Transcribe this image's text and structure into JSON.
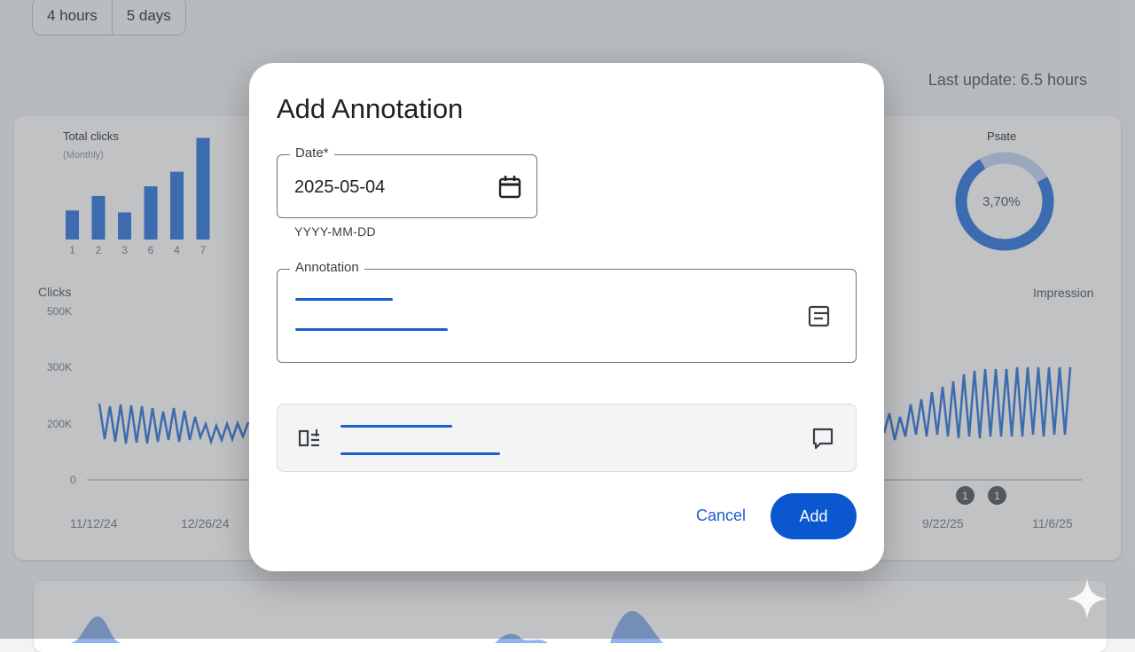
{
  "time_range": {
    "options": [
      "4 hours",
      "5 days"
    ]
  },
  "last_update": "Last update: 6.5 hours",
  "summary": {
    "total_clicks": {
      "title": "Total clicks",
      "subtitle": "(Monthly)",
      "chart_data": {
        "type": "bar",
        "categories": [
          "1",
          "2",
          "3",
          "6",
          "4",
          "7"
        ],
        "values": [
          3,
          4.5,
          2.8,
          5.5,
          7,
          10.5
        ]
      }
    },
    "position": {
      "title": "Psate",
      "chart_data": {
        "type": "pie",
        "values": [
          3.7
        ],
        "display": "3,70%"
      }
    }
  },
  "performance_chart": {
    "y_label": "Clicks",
    "y2_label": "Impression",
    "y_ticks": [
      "500K",
      "300K",
      "200K",
      "0"
    ],
    "x_ticks": [
      "11/12/24",
      "12/26/24",
      "9/22/25",
      "11/6/25"
    ],
    "annotation_markers": [
      "1",
      "1"
    ]
  },
  "dialog": {
    "title": "Add Annotation",
    "date_label": "Date*",
    "date_value": "2025-05-04",
    "date_helper": "YYYY-MM-DD",
    "annotation_label": "Annotation",
    "cancel_label": "Cancel",
    "add_label": "Add"
  },
  "colors": {
    "accent": "#0b57d0",
    "chart_line": "#3f7fe0",
    "donut": "#3f7fe0"
  },
  "icons": [
    "calendar-icon",
    "notes-icon",
    "list-add-icon",
    "comment-icon",
    "sparkle-icon"
  ]
}
